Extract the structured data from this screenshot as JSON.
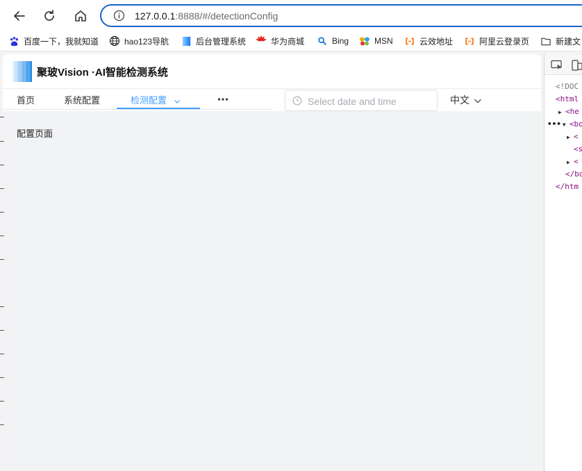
{
  "browser": {
    "url_host": "127.0.0.1",
    "url_rest": ":8888/#/detectionConfig",
    "nav": [
      "back-arrow-icon",
      "reload-icon",
      "home-icon"
    ]
  },
  "bookmarks": [
    {
      "label": "百度一下，我就知道",
      "icon": "baidu-icon"
    },
    {
      "label": "hao123导航",
      "icon": "globe-icon"
    },
    {
      "label": "后台管理系统",
      "icon": "blue-square-icon"
    },
    {
      "label": "华为商城",
      "icon": "huawei-icon"
    },
    {
      "label": "Bing",
      "icon": "search-icon"
    },
    {
      "label": "MSN",
      "icon": "msn-butterfly-icon"
    },
    {
      "label": "云效地址",
      "icon": "aliyun-icon"
    },
    {
      "label": "阿里云登录页",
      "icon": "aliyun-icon"
    },
    {
      "label": "新建文",
      "icon": "folder-icon"
    }
  ],
  "app": {
    "title": "聚玻Vision ·AI智能检测系统",
    "menu": [
      {
        "label": "首页"
      },
      {
        "label": "系统配置"
      },
      {
        "label": "检测配置",
        "active": true
      }
    ],
    "date_placeholder": "Select date and time",
    "language": "中文",
    "page_text": "配置页面",
    "accent_color": "#409eff"
  },
  "devtools": {
    "lines": [
      "<!DOC",
      "<html",
      "<he",
      "<bo",
      "<",
      "<s",
      "<",
      "</bo",
      "</htm"
    ]
  }
}
